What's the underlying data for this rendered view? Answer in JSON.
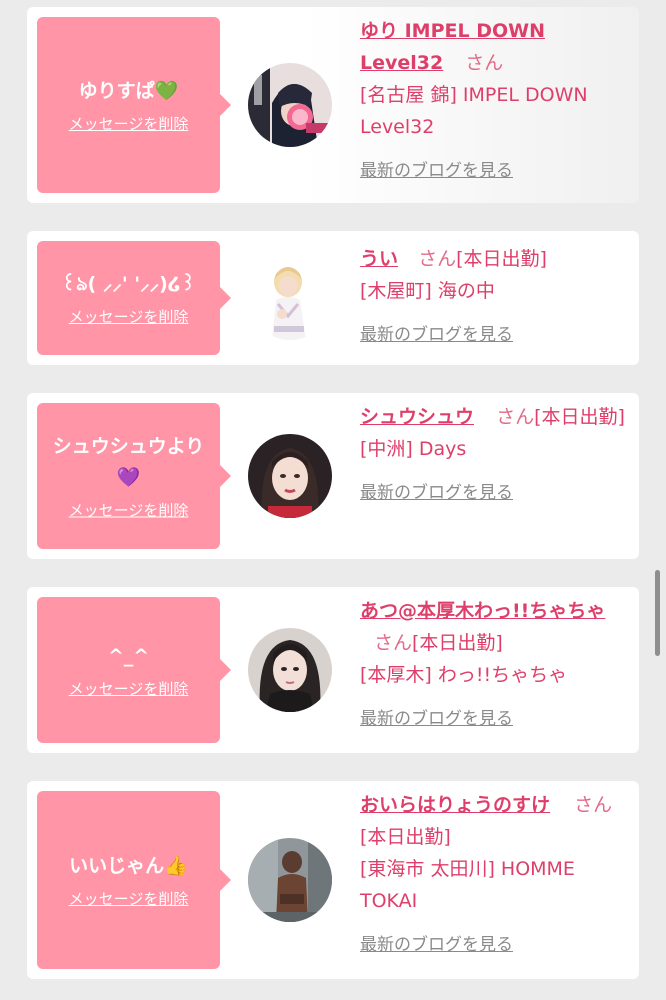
{
  "cards": [
    {
      "message": "ゆりすぱ💚",
      "delete_label": "メッセージを削除",
      "name": "ゆり IMPEL DOWN Level32",
      "name_suffix": "さん",
      "status": "",
      "location": "[名古屋 錦] IMPEL DOWN Level32",
      "blog_link": "最新のブログを見る"
    },
    {
      "message": "꒰ঌ( ⸝⸝'  '⸝⸝)໒꒱",
      "delete_label": "メッセージを削除",
      "name": "うい",
      "name_suffix": "さん",
      "status": "[本日出勤]",
      "location": "[木屋町] 海の中",
      "blog_link": "最新のブログを見る"
    },
    {
      "message": "シュウシュウより💜",
      "delete_label": "メッセージを削除",
      "name": "シュウシュウ",
      "name_suffix": "さん",
      "status": "[本日出勤]",
      "location": "[中洲] Days",
      "blog_link": "最新のブログを見る"
    },
    {
      "message": "^_^",
      "delete_label": "メッセージを削除",
      "name": "あつ@本厚木わっ!!ちゃちゃ",
      "name_suffix": "さん",
      "status": "[本日出勤]",
      "location": "[本厚木] わっ!!ちゃちゃ",
      "blog_link": "最新のブログを見る"
    },
    {
      "message": "いいじゃん👍",
      "delete_label": "メッセージを削除",
      "name": "おいらはりょうのすけ",
      "name_suffix": "さん",
      "status": "[本日出勤]",
      "location": "[東海市 太田川] HOMME TOKAI",
      "blog_link": "最新のブログを見る"
    }
  ],
  "colors": {
    "page_background": "#ebebeb",
    "card_background": "#ffffff",
    "bubble": "#ff95a6",
    "name_text": "#de3f6a",
    "blog_link": "#8a8a8a"
  }
}
